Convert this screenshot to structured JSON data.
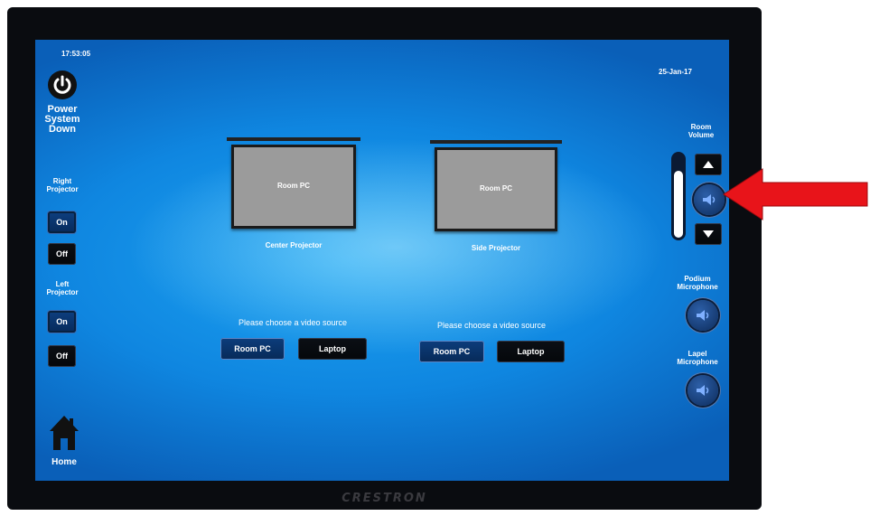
{
  "panel": {
    "time": "17:53:05",
    "date": "25-Jan-17",
    "brand": "CRESTRON"
  },
  "sidebar": {
    "power_label_1": "Power",
    "power_label_2": "System",
    "power_label_3": "Down",
    "right_projector_1": "Right",
    "right_projector_2": "Projector",
    "right_on": "On",
    "right_off": "Off",
    "left_projector_1": "Left",
    "left_projector_2": "Projector",
    "left_on": "On",
    "left_off": "Off",
    "home_label": "Home"
  },
  "projectors": {
    "center": {
      "screen_text": "Room PC",
      "label": "Center Projector",
      "prompt": "Please choose a video source",
      "source_1": "Room PC",
      "source_2": "Laptop"
    },
    "side": {
      "screen_text": "Room PC",
      "label": "Side Projector",
      "prompt": "Please choose a video source",
      "source_1": "Room PC",
      "source_2": "Laptop"
    }
  },
  "audio": {
    "room_volume_1": "Room",
    "room_volume_2": "Volume",
    "volume_level": 0.82,
    "podium_1": "Podium",
    "podium_2": "Microphone",
    "lapel_1": "Lapel",
    "lapel_2": "Microphone"
  },
  "icons": {
    "power": "power-icon",
    "home": "home-icon",
    "volume_up": "triangle-up-icon",
    "volume_down": "triangle-down-icon",
    "mute": "speaker-icon",
    "arrow": "red-arrow-icon"
  },
  "colors": {
    "screen_blue": "#0f86e0",
    "annotation_arrow": "#e8141a"
  }
}
